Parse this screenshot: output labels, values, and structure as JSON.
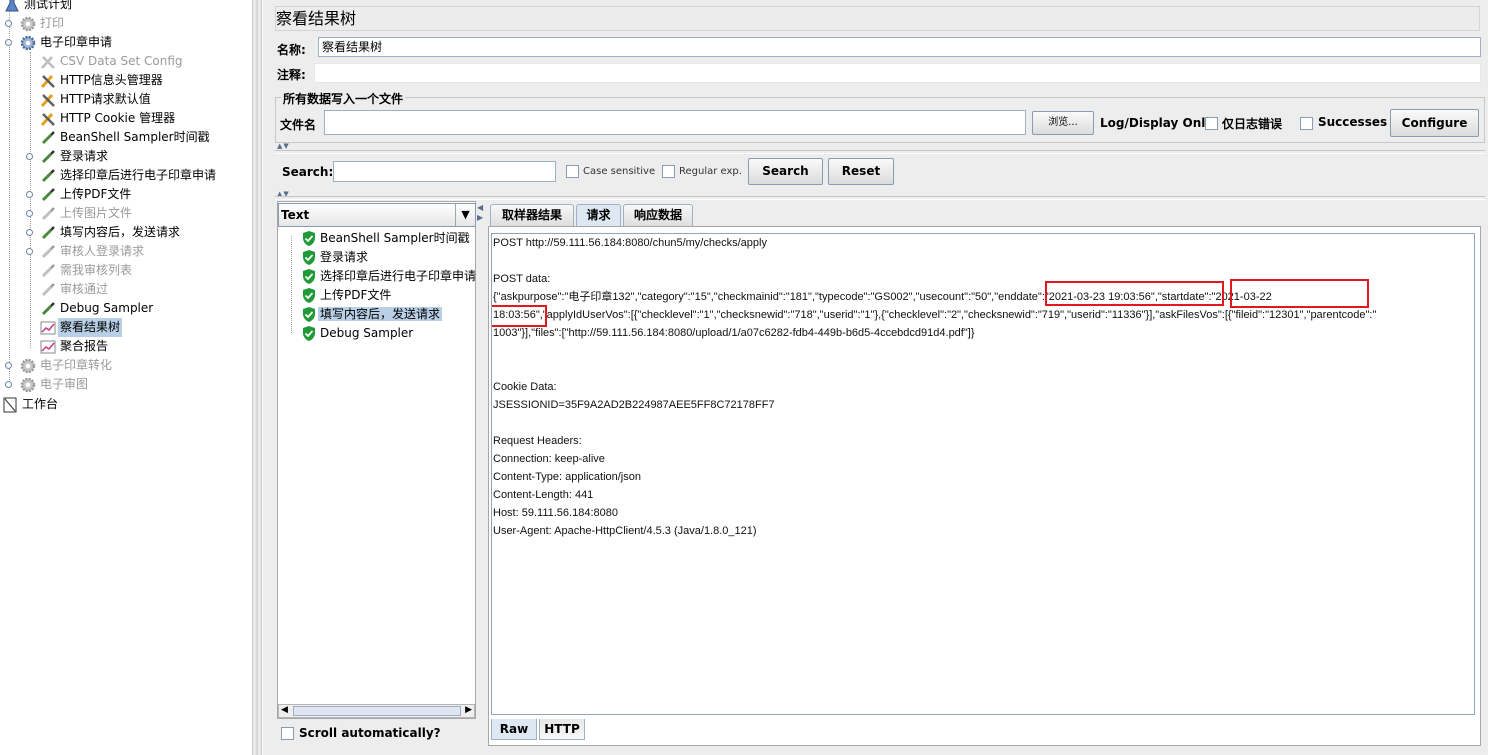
{
  "tree": {
    "items": [
      {
        "label": "测试计划",
        "disabled": false,
        "icon": "test-plan-icon"
      },
      {
        "label": "打印",
        "disabled": true,
        "icon": "thread-group-gear-icon"
      },
      {
        "label": "电子印章申请",
        "disabled": false,
        "icon": "thread-group-gear-icon"
      },
      {
        "label": "CSV Data Set Config",
        "disabled": true,
        "icon": "config-wrench-icon"
      },
      {
        "label": "HTTP信息头管理器",
        "disabled": false,
        "icon": "config-wrench-icon"
      },
      {
        "label": "HTTP请求默认值",
        "disabled": false,
        "icon": "config-wrench-icon"
      },
      {
        "label": "HTTP Cookie 管理器",
        "disabled": false,
        "icon": "config-wrench-icon"
      },
      {
        "label": "BeanShell Sampler时间戳",
        "disabled": false,
        "icon": "sampler-pipette-icon"
      },
      {
        "label": "登录请求",
        "disabled": false,
        "icon": "sampler-pipette-icon"
      },
      {
        "label": "选择印章后进行电子印章申请",
        "disabled": false,
        "icon": "sampler-pipette-icon"
      },
      {
        "label": "上传PDF文件",
        "disabled": false,
        "icon": "sampler-pipette-icon"
      },
      {
        "label": "上传图片文件",
        "disabled": true,
        "icon": "sampler-pipette-icon"
      },
      {
        "label": "填写内容后，发送请求",
        "disabled": false,
        "icon": "sampler-pipette-icon"
      },
      {
        "label": "审核人登录请求",
        "disabled": true,
        "icon": "sampler-pipette-icon"
      },
      {
        "label": "需我审核列表",
        "disabled": true,
        "icon": "sampler-pipette-icon"
      },
      {
        "label": "审核通过",
        "disabled": true,
        "icon": "sampler-pipette-icon"
      },
      {
        "label": "Debug Sampler",
        "disabled": false,
        "icon": "sampler-pipette-icon"
      },
      {
        "label": "察看结果树",
        "disabled": false,
        "icon": "listener-graph-icon"
      },
      {
        "label": "聚合报告",
        "disabled": false,
        "icon": "listener-graph-icon"
      },
      {
        "label": "电子印章转化",
        "disabled": true,
        "icon": "thread-group-gear-icon"
      },
      {
        "label": "电子审图",
        "disabled": true,
        "icon": "thread-group-gear-icon"
      },
      {
        "label": "工作台",
        "disabled": false,
        "icon": "workbench-icon"
      }
    ]
  },
  "panel": {
    "title": "察看结果树",
    "name_label": "名称:",
    "name_value": "察看结果树",
    "comment_label": "注释:",
    "comment_value": "",
    "file_group_title": "所有数据写入一个文件",
    "filename_label": "文件名",
    "filename_value": "",
    "browse_label": "浏览...",
    "log_display_label": "Log/Display Only:",
    "errors_only_label": "仅日志错误",
    "successes_label": "Successes",
    "configure_label": "Configure"
  },
  "search": {
    "label": "Search:",
    "value": "",
    "case_sensitive_label": "Case sensitive",
    "regex_label": "Regular exp.",
    "search_button": "Search",
    "reset_button": "Reset"
  },
  "results": {
    "renderer": "Text",
    "items": [
      {
        "label": "BeanShell Sampler时间戳"
      },
      {
        "label": "登录请求"
      },
      {
        "label": "选择印章后进行电子印章申请"
      },
      {
        "label": "上传PDF文件"
      },
      {
        "label": "填写内容后，发送请求"
      },
      {
        "label": "Debug Sampler"
      }
    ],
    "scroll_auto_label": "Scroll automatically?"
  },
  "tabs": [
    {
      "label": "取样器结果"
    },
    {
      "label": "请求"
    },
    {
      "label": "响应数据"
    }
  ],
  "bottom_tabs": [
    {
      "label": "Raw"
    },
    {
      "label": "HTTP"
    }
  ],
  "request": {
    "lines": [
      "POST http://59.111.56.184:8080/chun5/my/checks/apply",
      "",
      "POST data:",
      "{\"askpurpose\":\"电子印章132\",\"category\":\"15\",\"checkmainid\":\"181\",\"typecode\":\"GS002\",\"usecount\":\"50\",\"enddate\":\"2021-03-23 19:03:56\",\"startdate\":\"2021-03-22",
      "18:03:56\",\"applyIdUserVos\":[{\"checklevel\":\"1\",\"checksnewid\":\"718\",\"userid\":\"1\"},{\"checklevel\":\"2\",\"checksnewid\":\"719\",\"userid\":\"11336\"}],\"askFilesVos\":[{\"fileid\":\"12301\",\"parentcode\":\"",
      "1003\"}],\"files\":[\"http://59.111.56.184:8080/upload/1/a07c6282-fdb4-449b-b6d5-4ccebdcd91d4.pdf\"]}",
      "",
      "",
      "Cookie Data:",
      "JSESSIONID=35F9A2AD2B224987AEE5FF8C72178FF7",
      "",
      "Request Headers:",
      "Connection: keep-alive",
      "Content-Type: application/json",
      "Content-Length: 441",
      "Host: 59.111.56.184:8080",
      "User-Agent: Apache-HttpClient/4.5.3 (Java/1.8.0_121)"
    ]
  },
  "colors": {
    "highlight_box": "#e0191e",
    "selection": "#b8cfe5",
    "panel_bg": "#ededed"
  }
}
